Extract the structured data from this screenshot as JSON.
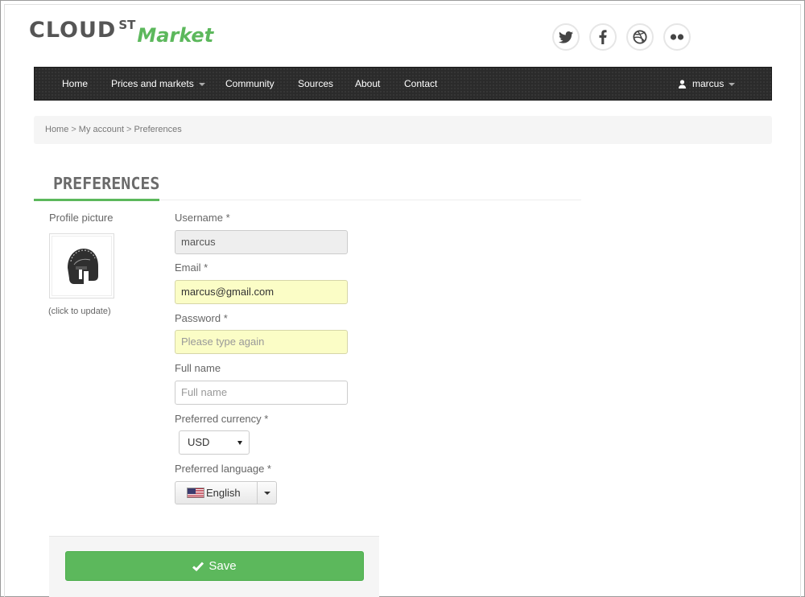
{
  "logo": {
    "brand": "CLOUD",
    "superscript": "ST",
    "suffix": "Market"
  },
  "social": [
    {
      "icon": "twitter-icon"
    },
    {
      "icon": "facebook-icon"
    },
    {
      "icon": "dribbble-icon"
    },
    {
      "icon": "flickr-icon"
    }
  ],
  "nav": {
    "items": [
      {
        "label": "Home"
      },
      {
        "label": "Prices and markets"
      },
      {
        "label": "Community"
      },
      {
        "label": "Sources"
      },
      {
        "label": "About"
      },
      {
        "label": "Contact"
      }
    ],
    "user": "marcus"
  },
  "breadcrumb": {
    "items": [
      "Home",
      "My account",
      "Preferences"
    ],
    "separator": ">"
  },
  "page_title": "PREFERENCES",
  "profile": {
    "label": "Profile picture",
    "hint": "(click to update)"
  },
  "form": {
    "username": {
      "label": "Username *",
      "value": "marcus"
    },
    "email": {
      "label": "Email *",
      "value": "marcus@gmail.com"
    },
    "password": {
      "label": "Password *",
      "placeholder": "Please type again"
    },
    "full_name": {
      "label": "Full name",
      "placeholder": "Full name"
    },
    "currency": {
      "label": "Preferred currency *",
      "selected": "USD"
    },
    "language": {
      "label": "Preferred language *",
      "selected": "English"
    }
  },
  "save_label": "Save",
  "colors": {
    "accent": "#5cb85c",
    "navbar": "#2b2b2b",
    "autofill": "#fbfdc6"
  }
}
